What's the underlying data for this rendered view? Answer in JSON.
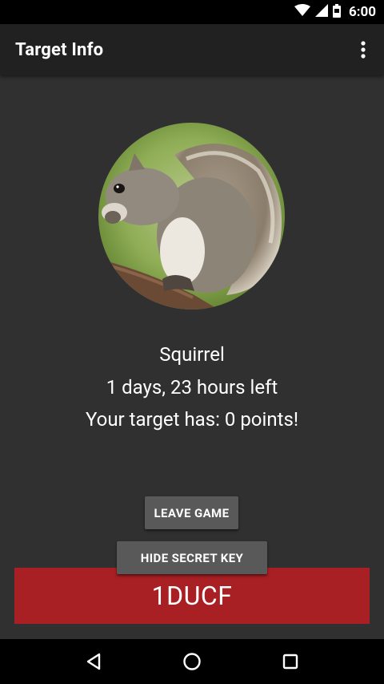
{
  "status_bar": {
    "time": "6:00",
    "icons": [
      "wifi-icon",
      "signal-icon",
      "battery-icon"
    ]
  },
  "app_bar": {
    "title": "Target Info",
    "overflow_icon": "more-vert-icon"
  },
  "target": {
    "image_alt": "squirrel",
    "name": "Squirrel",
    "time_left": "1 days, 23 hours left",
    "points_text": "Your target has: 0 points!"
  },
  "buttons": {
    "leave_game": "LEAVE GAME",
    "hide_secret_key": "HIDE SECRET KEY"
  },
  "secret_key": "1DUCF",
  "colors": {
    "background": "#303030",
    "app_bar": "#212121",
    "secret_bar": "#a81f24",
    "button": "#595959"
  },
  "nav_bar": {
    "icons": [
      "back-icon",
      "home-icon",
      "recents-icon"
    ]
  }
}
